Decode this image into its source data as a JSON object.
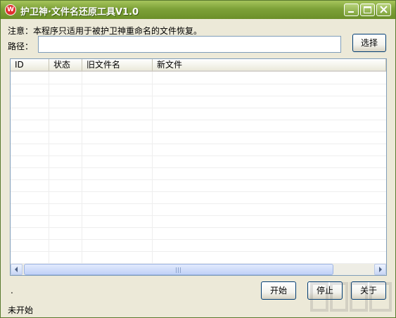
{
  "window": {
    "title": "护卫神·文件名还原工具V1.0",
    "app_icon_letter": "W"
  },
  "notice": "注意：本程序只适用于被护卫神重命名的文件恢复。",
  "path": {
    "label": "路径：",
    "value": "",
    "placeholder": ""
  },
  "buttons": {
    "browse": "选择",
    "start": "开始",
    "stop": "停止",
    "about": "关于"
  },
  "table": {
    "columns": [
      "ID",
      "状态",
      "旧文件名",
      "新文件"
    ],
    "rows": []
  },
  "status_dot": ".",
  "status_text": "未开始",
  "colors": {
    "titlebar": "#7da138",
    "window_bg": "#ece9d8",
    "button_border": "#003c74"
  }
}
